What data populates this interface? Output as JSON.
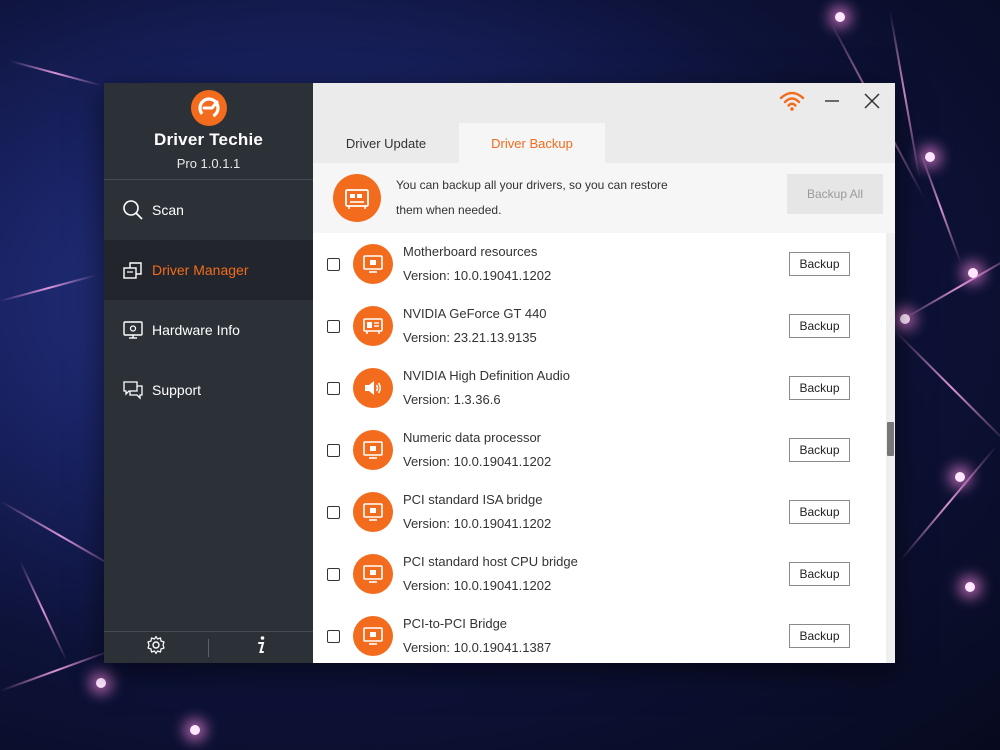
{
  "app": {
    "name": "Driver Techie",
    "version": "Pro 1.0.1.1"
  },
  "sidebar": {
    "items": [
      {
        "label": "Scan",
        "icon": "search-icon",
        "active": false
      },
      {
        "label": "Driver Manager",
        "icon": "driver-manager-icon",
        "active": true
      },
      {
        "label": "Hardware Info",
        "icon": "monitor-icon",
        "active": false
      },
      {
        "label": "Support",
        "icon": "chat-icon",
        "active": false
      }
    ],
    "footer": {
      "settings_icon": "gear-icon",
      "info_icon": "info-icon"
    }
  },
  "titlebar": {
    "icons": [
      "wifi-icon",
      "minimize-icon",
      "close-icon"
    ]
  },
  "tabs": [
    {
      "label": "Driver Update",
      "active": false
    },
    {
      "label": "Driver Backup",
      "active": true
    }
  ],
  "banner": {
    "line1": "You can backup all your drivers, so you can restore",
    "line2": "them when needed.",
    "backup_all_label": "Backup All"
  },
  "drivers": [
    {
      "name": "Motherboard resources",
      "version": "Version: 10.0.19041.1202",
      "icon": "monitor-icon",
      "backup_label": "Backup"
    },
    {
      "name": "NVIDIA GeForce GT 440",
      "version": "Version: 23.21.13.9135",
      "icon": "graphics-card-icon",
      "backup_label": "Backup"
    },
    {
      "name": "NVIDIA High Definition Audio",
      "version": "Version: 1.3.36.6",
      "icon": "speaker-icon",
      "backup_label": "Backup"
    },
    {
      "name": "Numeric data processor",
      "version": "Version: 10.0.19041.1202",
      "icon": "monitor-icon",
      "backup_label": "Backup"
    },
    {
      "name": "PCI standard ISA bridge",
      "version": "Version: 10.0.19041.1202",
      "icon": "monitor-icon",
      "backup_label": "Backup"
    },
    {
      "name": "PCI standard host CPU bridge",
      "version": "Version: 10.0.19041.1202",
      "icon": "monitor-icon",
      "backup_label": "Backup"
    },
    {
      "name": "PCI-to-PCI Bridge",
      "version": "Version: 10.0.19041.1387",
      "icon": "monitor-icon",
      "backup_label": "Backup"
    }
  ],
  "colors": {
    "accent": "#f36b1c",
    "sidebar_bg": "#2c3138",
    "sidebar_active_bg": "#22262c"
  }
}
